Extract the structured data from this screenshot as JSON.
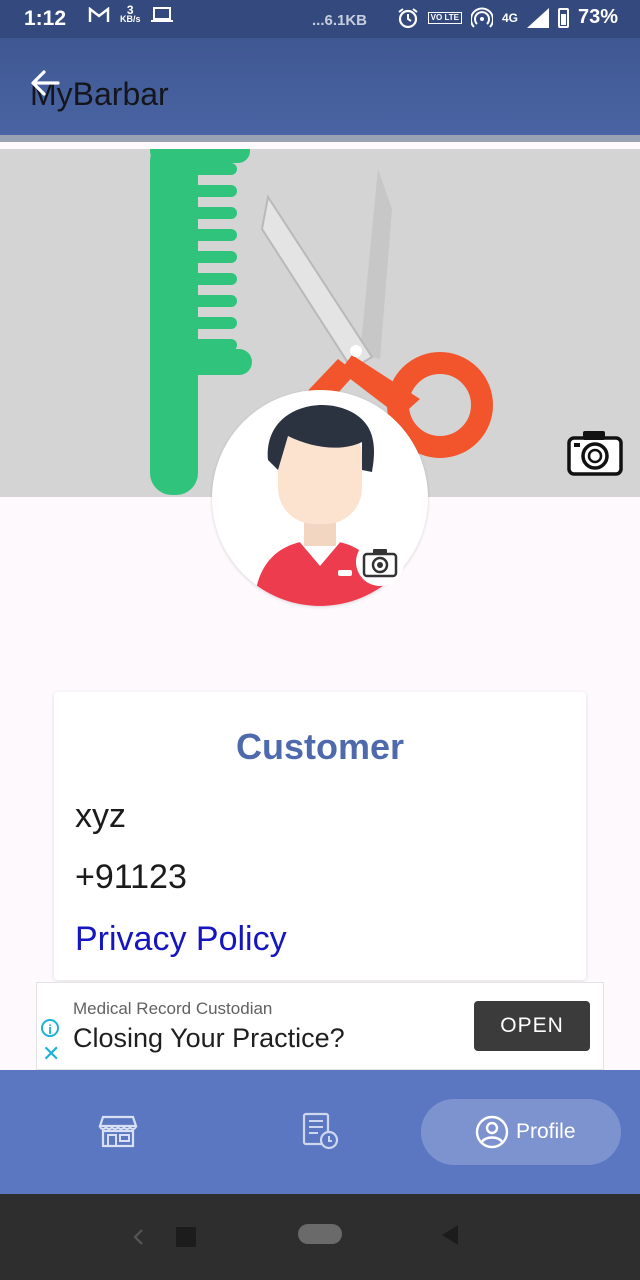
{
  "status_bar": {
    "time": "1:12",
    "kbs_value": "3",
    "kbs_unit": "KB/s",
    "net_speed": "...6.1KB",
    "volte": "VO LTE",
    "network": "4G",
    "battery": "73%"
  },
  "app_bar": {
    "title": "MyBarbar"
  },
  "profile": {
    "role": "Customer",
    "name": "xyz",
    "phone": "+91123",
    "privacy_link": "Privacy Policy"
  },
  "ad": {
    "info_glyph": "i",
    "close_glyph": "✕",
    "source": "Medical Record Custodian",
    "headline": "Closing Your Practice?",
    "button": "OPEN"
  },
  "bottom_nav": {
    "items": [
      {
        "icon": "store-icon"
      },
      {
        "icon": "bookings-icon"
      },
      {
        "icon": "profile-icon",
        "label": "Profile",
        "selected": true
      }
    ]
  },
  "colors": {
    "app_bar": "#4a64a4",
    "accent": "#4e6aac",
    "link": "#1616c0",
    "bottom_nav": "#5b77c1",
    "comb": "#2fc37c",
    "scissors_handle": "#f2552c"
  }
}
